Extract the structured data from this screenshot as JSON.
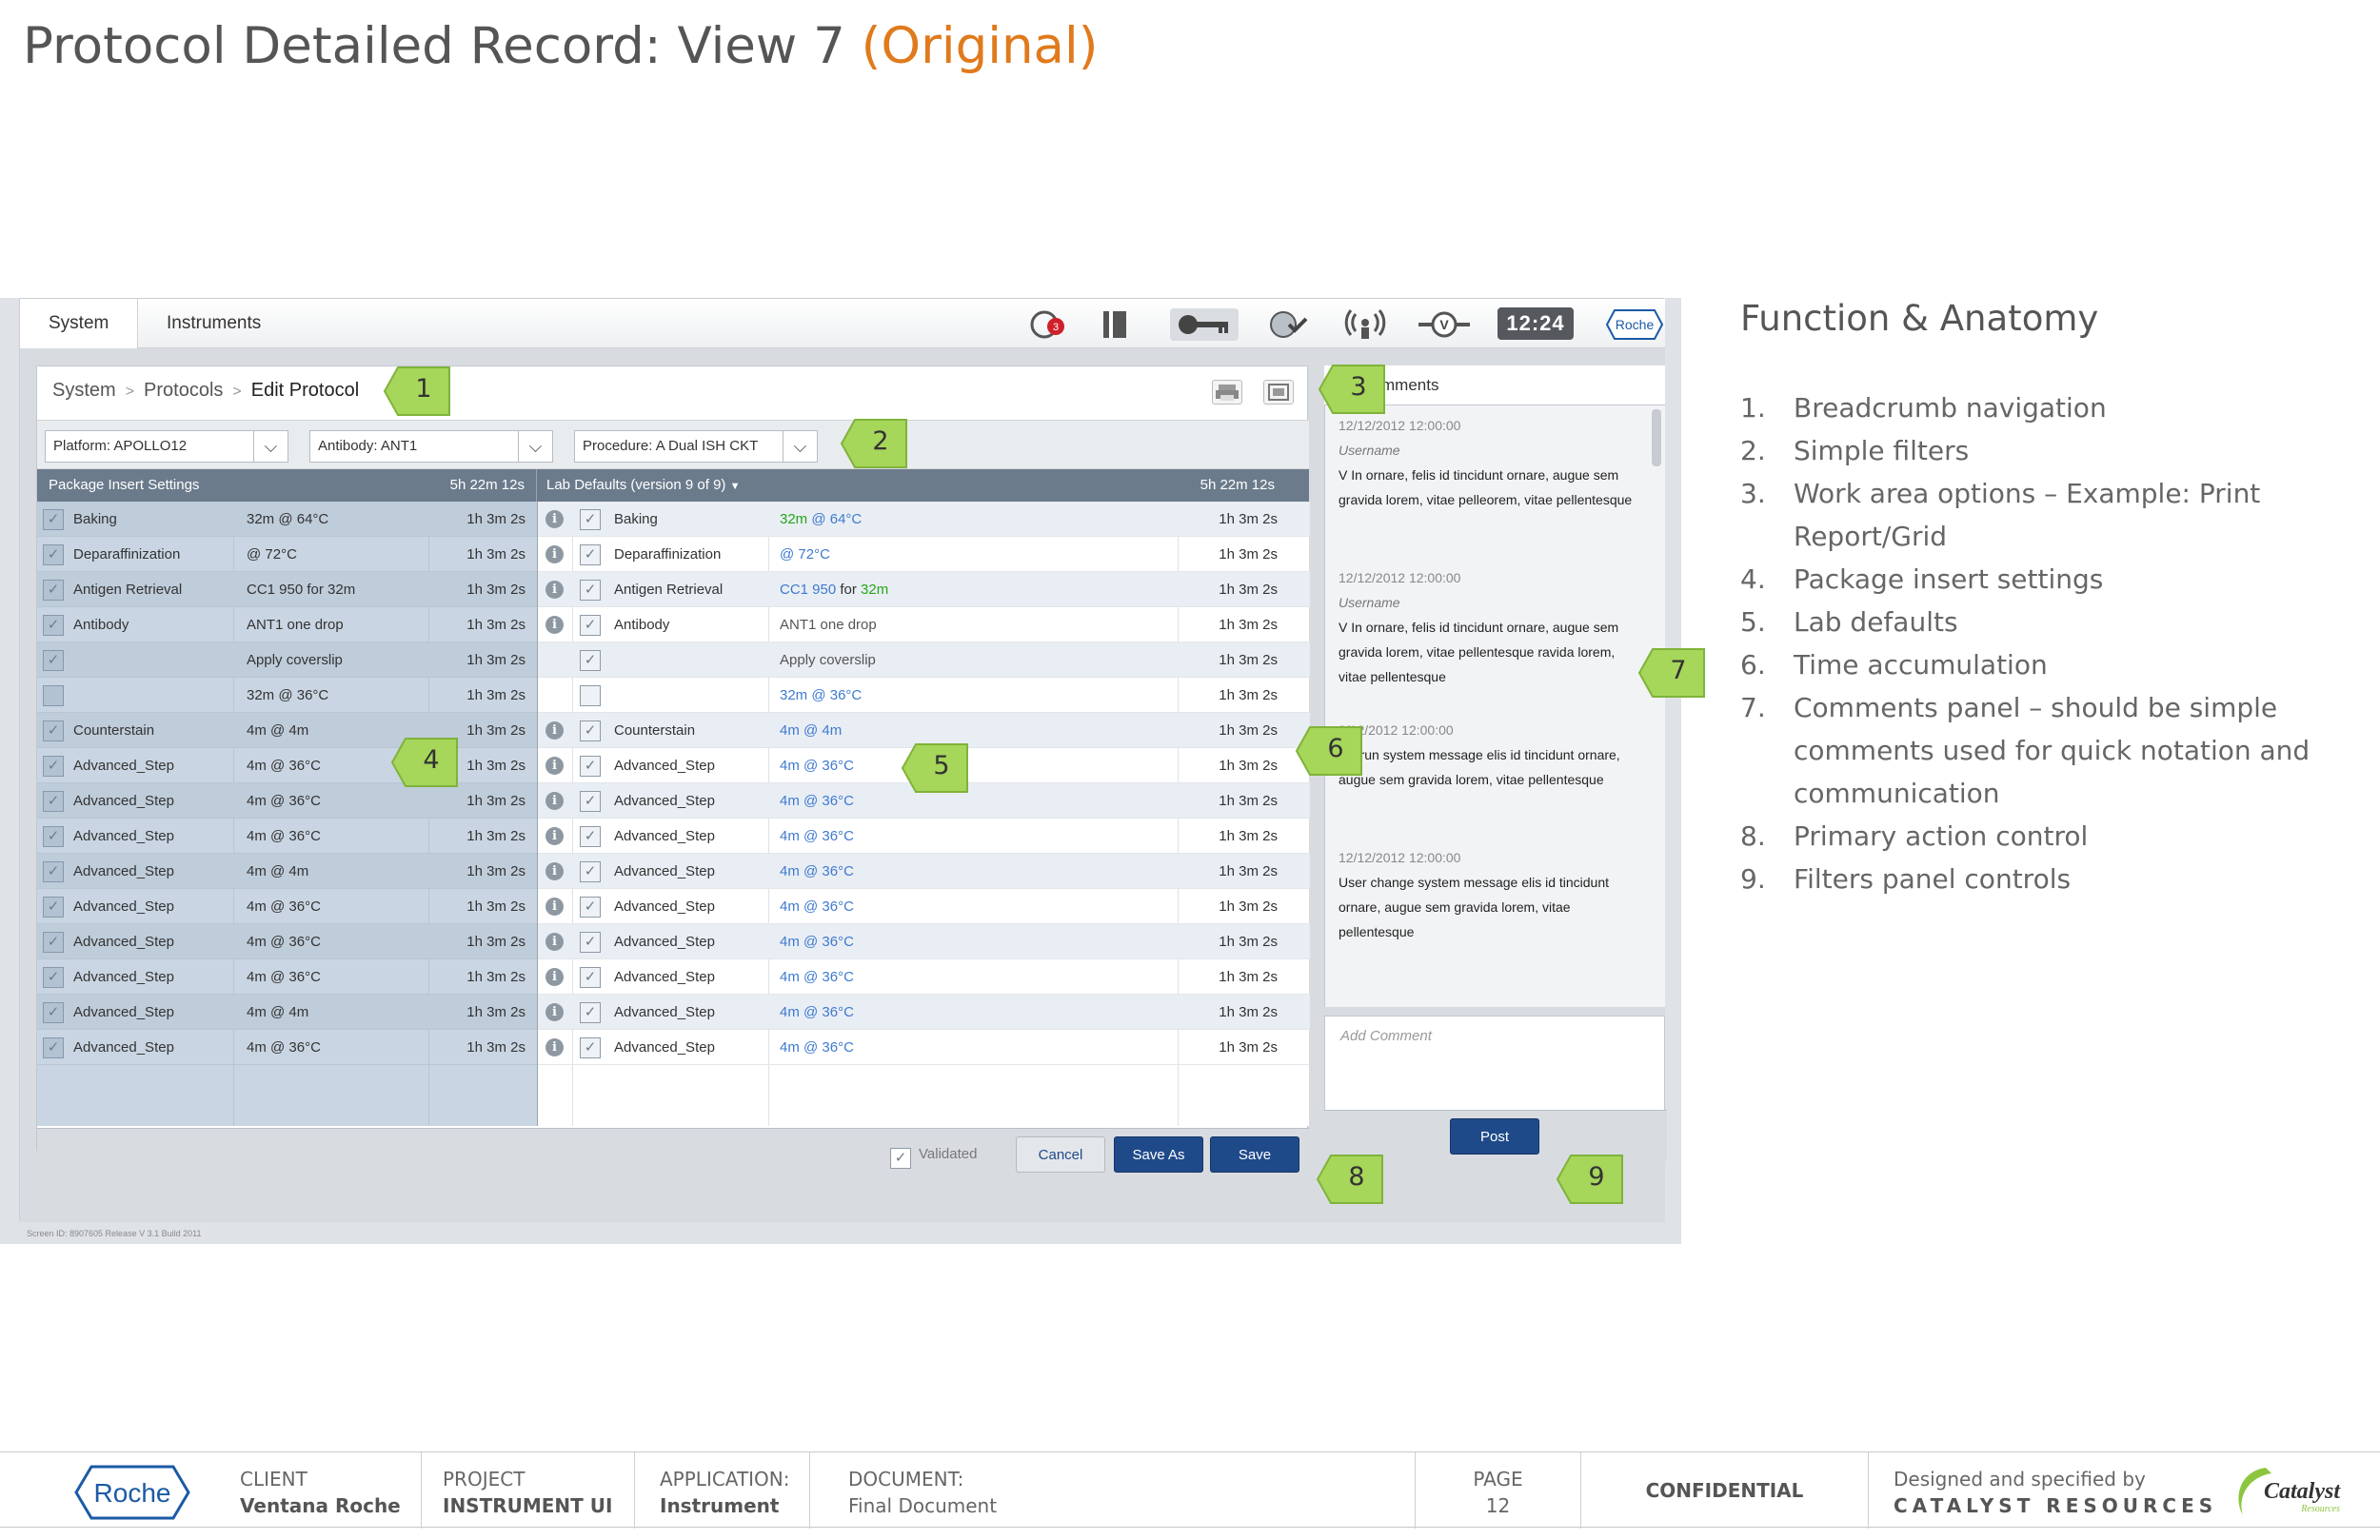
{
  "page": {
    "title": "Protocol Detailed Record:  View 7 ",
    "title_variant": "(Original)"
  },
  "app": {
    "tabs": [
      {
        "label": "System"
      },
      {
        "label": "Instruments"
      }
    ],
    "clock": "12:24",
    "alert_count": "3",
    "brand": "Roche",
    "breadcrumb": {
      "items": [
        "System",
        "Protocols"
      ],
      "current": "Edit Protocol"
    },
    "filters": {
      "platform": "Platform: APOLLO12",
      "antibody": "Antibody: ANT1",
      "procedure": "Procedure: A Dual ISH CKT"
    },
    "package": {
      "header": "Package Insert Settings",
      "total": "5h 22m 12s",
      "rows": [
        {
          "step": "Baking",
          "setting": "32m @ 64°C",
          "time": "1h 3m 2s",
          "checked": "✓"
        },
        {
          "step": "Deparaffinization",
          "setting": "@ 72°C",
          "time": "1h 3m 2s",
          "checked": "✓"
        },
        {
          "step": "Antigen Retrieval",
          "setting": "CC1  950  for 32m",
          "time": "1h 3m 2s",
          "checked": "✓"
        },
        {
          "step": "Antibody",
          "setting": "ANT1 one drop",
          "time": "1h 3m 2s",
          "checked": "✓"
        },
        {
          "step": "",
          "setting": "Apply coverslip",
          "time": "1h 3m 2s",
          "checked": "✓"
        },
        {
          "step": "",
          "setting": "32m @ 36°C",
          "time": "1h 3m 2s",
          "checked": ""
        },
        {
          "step": "Counterstain",
          "setting": "4m @ 4m",
          "time": "1h 3m 2s",
          "checked": "✓"
        },
        {
          "step": "Advanced_Step",
          "setting": "4m @ 36°C",
          "time": "1h 3m 2s",
          "checked": "✓"
        },
        {
          "step": "Advanced_Step",
          "setting": "4m @ 36°C",
          "time": "1h 3m 2s",
          "checked": "✓"
        },
        {
          "step": "Advanced_Step",
          "setting": "4m @ 36°C",
          "time": "1h 3m 2s",
          "checked": "✓"
        },
        {
          "step": "Advanced_Step",
          "setting": "4m @ 4m",
          "time": "1h 3m 2s",
          "checked": "✓"
        },
        {
          "step": "Advanced_Step",
          "setting": "4m @ 36°C",
          "time": "1h 3m 2s",
          "checked": "✓"
        },
        {
          "step": "Advanced_Step",
          "setting": "4m @ 36°C",
          "time": "1h 3m 2s",
          "checked": "✓"
        },
        {
          "step": "Advanced_Step",
          "setting": "4m @ 36°C",
          "time": "1h 3m 2s",
          "checked": "✓"
        },
        {
          "step": "Advanced_Step",
          "setting": "4m @ 4m",
          "time": "1h 3m 2s",
          "checked": "✓"
        },
        {
          "step": "Advanced_Step",
          "setting": "4m @ 36°C",
          "time": "1h 3m 2s",
          "checked": "✓"
        }
      ]
    },
    "lab": {
      "header": "Lab Defaults (version 9 of 9)",
      "total": "5h 22m 12s",
      "rows": [
        {
          "step": "Baking",
          "s1": "32m",
          "s2": " @ ",
          "s3": "64°C",
          "s4": "",
          "time": "1h 3m 2s",
          "checked": "✓",
          "info": "i"
        },
        {
          "step": "Deparaffinization",
          "s1": "",
          "s2": "@ ",
          "s3": "72°C",
          "s4": "",
          "time": "1h 3m 2s",
          "checked": "✓",
          "info": "i"
        },
        {
          "step": "Antigen Retrieval",
          "s1": "CC1  950",
          "s2": "  for ",
          "s3": "32m",
          "s4": "",
          "time": "1h 3m 2s",
          "checked": "✓",
          "info": "i"
        },
        {
          "step": "Antibody",
          "s1": "",
          "s2": "ANT1 one drop",
          "s3": "",
          "s4": "",
          "time": "1h 3m 2s",
          "checked": "✓",
          "info": "i"
        },
        {
          "step": "",
          "s1": "",
          "s2": "Apply coverslip",
          "s3": "",
          "s4": "",
          "time": "1h 3m 2s",
          "checked": "✓",
          "info": ""
        },
        {
          "step": "",
          "s1": "32m",
          "s2": " @ ",
          "s3": "36°C",
          "s4": "",
          "time": "1h 3m 2s",
          "checked": "",
          "info": ""
        },
        {
          "step": "Counterstain",
          "s1": "4m",
          "s2": " @ ",
          "s3": "4m",
          "s4": "",
          "time": "1h 3m 2s",
          "checked": "✓",
          "info": "i"
        },
        {
          "step": "Advanced_Step",
          "s1": "4m",
          "s2": " @ ",
          "s3": "36°C",
          "s4": "",
          "time": "1h 3m 2s",
          "checked": "✓",
          "info": "i"
        },
        {
          "step": "Advanced_Step",
          "s1": "4m",
          "s2": " @ ",
          "s3": "36°C",
          "s4": "",
          "time": "1h 3m 2s",
          "checked": "✓",
          "info": "i"
        },
        {
          "step": "Advanced_Step",
          "s1": "4m",
          "s2": " @ ",
          "s3": "36°C",
          "s4": "",
          "time": "1h 3m 2s",
          "checked": "✓",
          "info": "i"
        },
        {
          "step": "Advanced_Step",
          "s1": "4m",
          "s2": " @ ",
          "s3": "36°C",
          "s4": "",
          "time": "1h 3m 2s",
          "checked": "✓",
          "info": "i"
        },
        {
          "step": "Advanced_Step",
          "s1": "4m",
          "s2": " @ ",
          "s3": "36°C",
          "s4": "",
          "time": "1h 3m 2s",
          "checked": "✓",
          "info": "i"
        },
        {
          "step": "Advanced_Step",
          "s1": "4m",
          "s2": " @ ",
          "s3": "36°C",
          "s4": "",
          "time": "1h 3m 2s",
          "checked": "✓",
          "info": "i"
        },
        {
          "step": "Advanced_Step",
          "s1": "4m",
          "s2": " @ ",
          "s3": "36°C",
          "s4": "",
          "time": "1h 3m 2s",
          "checked": "✓",
          "info": "i"
        },
        {
          "step": "Advanced_Step",
          "s1": "4m",
          "s2": " @ ",
          "s3": "36°C",
          "s4": "",
          "time": "1h 3m 2s",
          "checked": "✓",
          "info": "i"
        },
        {
          "step": "Advanced_Step",
          "s1": "4m",
          "s2": " @ ",
          "s3": "36°C",
          "s4": "",
          "time": "1h 3m 2s",
          "checked": "✓",
          "info": "i"
        }
      ]
    },
    "actions": {
      "validated": "Validated",
      "cancel": "Cancel",
      "save_as": "Save As",
      "save": "Save"
    },
    "comments": {
      "header": "Comments",
      "header_visible": "mments",
      "items": [
        {
          "ts": "12/12/2012 12:00:00",
          "user": "Username",
          "text": "V In ornare, felis id tincidunt ornare, augue sem gravida lorem, vitae pelleorem, vitae pellentesque"
        },
        {
          "ts": "12/12/2012 12:00:00",
          "user": "Username",
          "text": "V In ornare, felis id tincidunt ornare, augue sem gravida lorem, vitae pellentesque ravida lorem, vitae pellentesque"
        },
        {
          "ts": "2/12/2012 12:00:00",
          "user": "",
          "text": "ast run system message elis id tincidunt ornare, augue sem gravida lorem, vitae pellentesque"
        },
        {
          "ts": "12/12/2012 12:00:00",
          "user": "",
          "text": "User change system message elis id tincidunt ornare, augue sem gravida lorem, vitae pellentesque"
        }
      ],
      "add_placeholder": "Add Comment",
      "post": "Post"
    },
    "meta": "Screen ID: 8907605     Release V 3.1     Build 2011"
  },
  "callouts": [
    "1",
    "2",
    "3",
    "4",
    "5",
    "6",
    "7",
    "8",
    "9"
  ],
  "anatomy": {
    "title": "Function & Anatomy",
    "items": [
      {
        "n": "1.",
        "t": "Breadcrumb navigation"
      },
      {
        "n": "2.",
        "t": "Simple filters"
      },
      {
        "n": "3.",
        "t": "Work area options – Example: Print Report/Grid"
      },
      {
        "n": "4.",
        "t": "Package insert settings"
      },
      {
        "n": "5.",
        "t": "Lab defaults"
      },
      {
        "n": "6.",
        "t": "Time accumulation"
      },
      {
        "n": "7.",
        "t": "Comments panel – should be simple comments used for quick notation and communication"
      },
      {
        "n": "8.",
        "t": "Primary action control"
      },
      {
        "n": "9.",
        "t": "Filters panel controls"
      }
    ]
  },
  "footer": {
    "client_label": "CLIENT",
    "client": "Ventana Roche",
    "project_label": "PROJECT",
    "project": "INSTRUMENT UI",
    "app_label": "APPLICATION:",
    "app": "Instrument",
    "doc_label": "DOCUMENT:",
    "doc": "Final Document",
    "page_label": "PAGE",
    "page": "12",
    "confidential": "CONFIDENTIAL",
    "designed": "Designed and specified by",
    "company": "CATALYST RESOURCES",
    "logo_text": "Catalyst",
    "logo_sub": "Resources"
  },
  "colors": {
    "accent": "#e07a1c",
    "primary_button": "#1f4a8a",
    "callout": "#a6d65a",
    "header_bar": "#6b7b8c"
  },
  "icons": [
    "alert-icon",
    "book-icon",
    "key-icon",
    "disc-check-icon",
    "signal-icon",
    "valve-icon",
    "printer-icon",
    "grid-icon",
    "chevron-down-icon",
    "info-icon",
    "checkbox-icon"
  ]
}
